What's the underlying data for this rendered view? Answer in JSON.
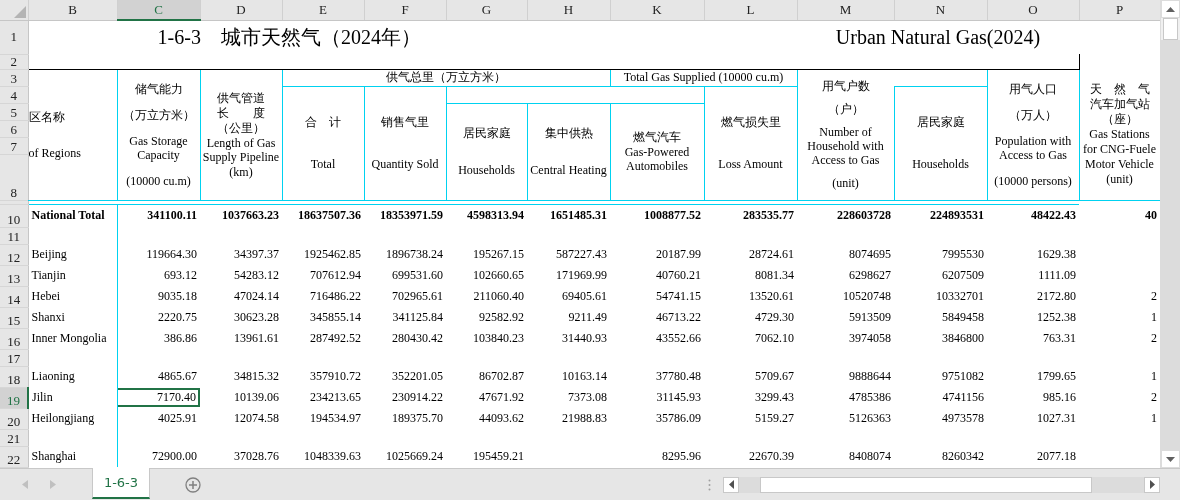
{
  "columns": [
    {
      "letter": "B",
      "selected": false
    },
    {
      "letter": "C",
      "selected": true
    },
    {
      "letter": "D",
      "selected": false
    },
    {
      "letter": "E",
      "selected": false
    },
    {
      "letter": "F",
      "selected": false
    },
    {
      "letter": "G",
      "selected": false
    },
    {
      "letter": "H",
      "selected": false
    },
    {
      "letter": "K",
      "selected": false
    },
    {
      "letter": "L",
      "selected": false
    },
    {
      "letter": "M",
      "selected": false
    },
    {
      "letter": "N",
      "selected": false
    },
    {
      "letter": "O",
      "selected": false
    },
    {
      "letter": "P",
      "selected": false
    }
  ],
  "header_rows": [
    {
      "label": "1",
      "selected": false
    },
    {
      "label": "2",
      "selected": false
    },
    {
      "label": "3",
      "selected": false
    },
    {
      "label": "4",
      "selected": false
    },
    {
      "label": "5",
      "selected": false
    },
    {
      "label": "6",
      "selected": false
    },
    {
      "label": "7",
      "selected": false
    },
    {
      "label": "8",
      "selected": false
    }
  ],
  "title_cn": "1-6-3　城市天然气（2024年）",
  "title_en": "Urban Natural Gas(2024)",
  "header": {
    "region": [
      "区名称",
      "of Regions"
    ],
    "storage": [
      "储气能力",
      "（万立方米）",
      "Gas Storage Capacity",
      "(10000 cu.m)"
    ],
    "pipeline": [
      "供气管道",
      "长　　度",
      "（公里）",
      "Length of Gas Supply Pipeline",
      "(km)"
    ],
    "supply_cn": "供气总里（万立方米）",
    "supply_en": "Total Gas Supplied (10000 cu.m)",
    "total": [
      "合　计",
      "Total"
    ],
    "sold": [
      "销售气里",
      "Quantity Sold"
    ],
    "households": [
      "居民家庭",
      "Households"
    ],
    "heating": [
      "集中供热",
      "Central Heating"
    ],
    "auto": [
      "燃气汽车",
      "Gas-Powered Automobiles"
    ],
    "loss": [
      "燃气损失里",
      "Loss Amount"
    ],
    "access": [
      "用气户数",
      "（户）",
      "Number of Household with Access to Gas",
      "(unit)"
    ],
    "residential": [
      "居民家庭",
      "Households"
    ],
    "population": [
      "用气人口",
      "（万人）",
      "Population with Access to Gas",
      "(10000 persons)"
    ],
    "stations": [
      "天　然　气",
      "汽车加气站",
      "（座）",
      "Gas Stations",
      "for CNG-Fuele",
      "Motor Vehicle",
      "(unit)"
    ]
  },
  "rows": [
    {
      "row": "10",
      "kind": "total",
      "selected": false,
      "cells": [
        "National Total",
        "341100.11",
        "1037663.23",
        "18637507.36",
        "18353971.59",
        "4598313.94",
        "1651485.31",
        "1008877.52",
        "283535.77",
        "228603728",
        "224893531",
        "48422.43",
        "40"
      ]
    },
    {
      "row": "11",
      "kind": "blank",
      "selected": false,
      "cells": []
    },
    {
      "row": "12",
      "kind": "data",
      "selected": false,
      "cells": [
        "Beijing",
        "119664.30",
        "34397.37",
        "1925462.85",
        "1896738.24",
        "195267.15",
        "587227.43",
        "20187.99",
        "28724.61",
        "8074695",
        "7995530",
        "1629.38",
        null
      ]
    },
    {
      "row": "13",
      "kind": "data",
      "selected": false,
      "cells": [
        "Tianjin",
        "693.12",
        "54283.12",
        "707612.94",
        "699531.60",
        "102660.65",
        "171969.99",
        "40760.21",
        "8081.34",
        "6298627",
        "6207509",
        "1111.09",
        null
      ]
    },
    {
      "row": "14",
      "kind": "data",
      "selected": false,
      "cells": [
        "Hebei",
        "9035.18",
        "47024.14",
        "716486.22",
        "702965.61",
        "211060.40",
        "69405.61",
        "54741.15",
        "13520.61",
        "10520748",
        "10332701",
        "2172.80",
        "2"
      ]
    },
    {
      "row": "15",
      "kind": "data",
      "selected": false,
      "cells": [
        "Shanxi",
        "2220.75",
        "30623.28",
        "345855.14",
        "341125.84",
        "92582.92",
        "9211.49",
        "46713.22",
        "4729.30",
        "5913509",
        "5849458",
        "1252.38",
        "1"
      ]
    },
    {
      "row": "16",
      "kind": "data",
      "selected": false,
      "cells": [
        "Inner Mongolia",
        "386.86",
        "13961.61",
        "287492.52",
        "280430.42",
        "103840.23",
        "31440.93",
        "43552.66",
        "7062.10",
        "3974058",
        "3846800",
        "763.31",
        "2"
      ]
    },
    {
      "row": "17",
      "kind": "blank",
      "selected": false,
      "cells": []
    },
    {
      "row": "18",
      "kind": "data",
      "selected": false,
      "cells": [
        "Liaoning",
        "4865.67",
        "34815.32",
        "357910.72",
        "352201.05",
        "86702.87",
        "10163.14",
        "37780.48",
        "5709.67",
        "9888644",
        "9751082",
        "1799.65",
        "1"
      ]
    },
    {
      "row": "19",
      "kind": "data",
      "selected": true,
      "cells": [
        "Jilin",
        "7170.40",
        "10139.06",
        "234213.65",
        "230914.22",
        "47671.92",
        "7373.08",
        "31145.93",
        "3299.43",
        "4785386",
        "4741156",
        "985.16",
        "2"
      ]
    },
    {
      "row": "20",
      "kind": "data",
      "selected": false,
      "cells": [
        "Heilongjiang",
        "4025.91",
        "12074.58",
        "194534.97",
        "189375.70",
        "44093.62",
        "21988.83",
        "35786.09",
        "5159.27",
        "5126363",
        "4973578",
        "1027.31",
        "1"
      ]
    },
    {
      "row": "21",
      "kind": "blank",
      "selected": false,
      "cells": []
    },
    {
      "row": "22",
      "kind": "data",
      "selected": false,
      "cells": [
        "Shanghai",
        "72900.00",
        "37028.76",
        "1048339.63",
        "1025669.24",
        "195459.21",
        null,
        "8295.96",
        "22670.39",
        "8408074",
        "8260342",
        "2077.18",
        null
      ]
    }
  ],
  "sheet_tabs": [
    {
      "label": "1-6-3",
      "selected": true
    }
  ]
}
